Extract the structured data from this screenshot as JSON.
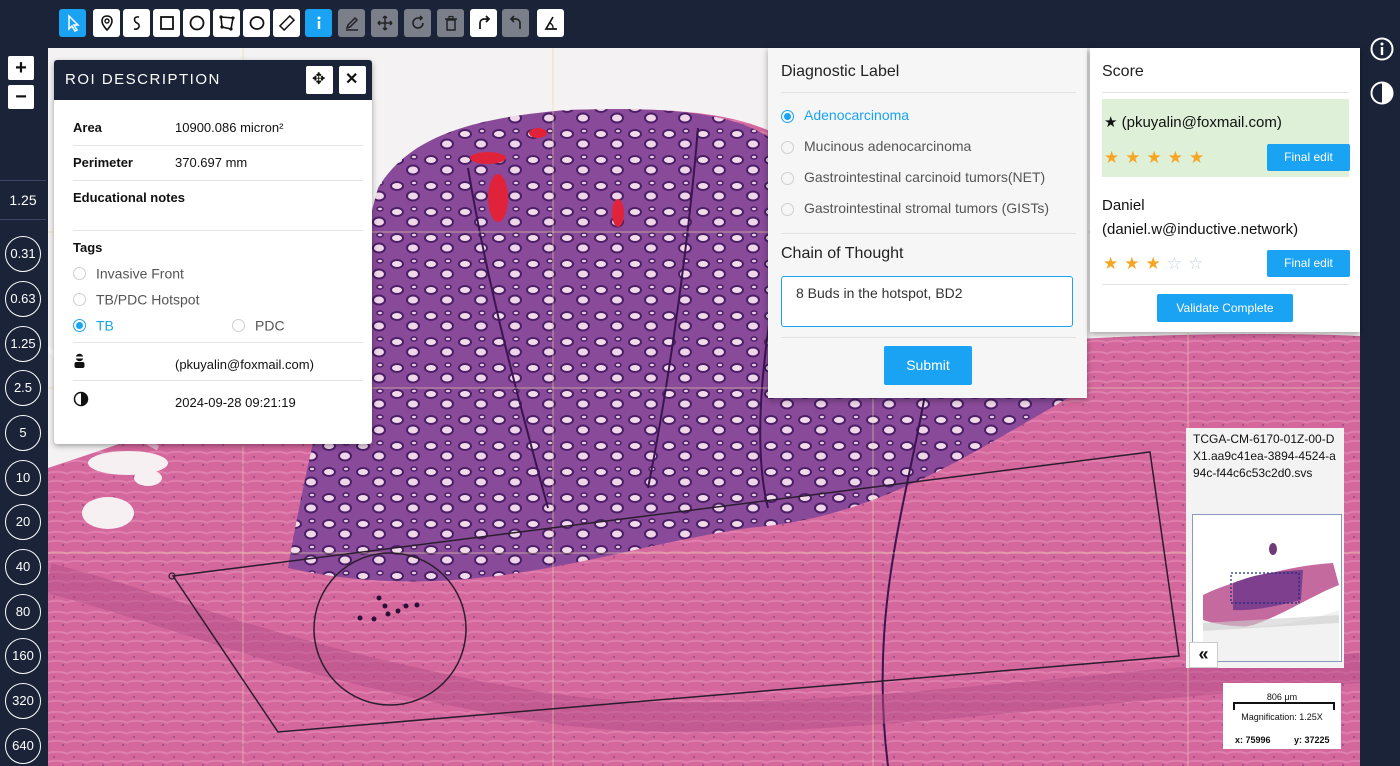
{
  "toolbar": {
    "tools": [
      {
        "name": "select-tool",
        "icon": "pointer-icon"
      },
      {
        "name": "point-tool",
        "icon": "map-pin-icon"
      },
      {
        "name": "freehand-tool",
        "icon": "freehand-icon"
      },
      {
        "name": "rectangle-tool",
        "icon": "square-icon"
      },
      {
        "name": "circle-tool",
        "icon": "circle-icon"
      },
      {
        "name": "polygon-tool",
        "icon": "polygon-icon"
      },
      {
        "name": "ellipse-tool",
        "icon": "ellipse-icon"
      },
      {
        "name": "ruler-tool",
        "icon": "ruler-icon"
      },
      {
        "name": "info-tool",
        "icon": "info-icon"
      },
      {
        "name": "edit-tool",
        "icon": "pencil-icon"
      },
      {
        "name": "move-tool",
        "icon": "move-icon"
      },
      {
        "name": "rotate-tool",
        "icon": "rotate-icon"
      },
      {
        "name": "delete-tool",
        "icon": "trash-icon"
      },
      {
        "name": "redo-tool",
        "icon": "redo-icon"
      },
      {
        "name": "undo-tool",
        "icon": "undo-icon"
      },
      {
        "name": "angle-tool",
        "icon": "angle-icon"
      }
    ]
  },
  "zoom": {
    "in_label": "+",
    "out_label": "−",
    "current": "1.25",
    "levels": [
      "0.31",
      "0.63",
      "1.25",
      "2.5",
      "5",
      "10",
      "20",
      "40",
      "80",
      "160",
      "320",
      "640"
    ]
  },
  "roi": {
    "title": "ROI DESCRIPTION",
    "area_label": "Area",
    "area_value": "10900.086 micron²",
    "perimeter_label": "Perimeter",
    "perimeter_value": "370.697 mm",
    "notes_label": "Educational notes",
    "tags_label": "Tags",
    "tags": {
      "invasive_front": "Invasive Front",
      "tb_pdc_hotspot": "TB/PDC Hotspot",
      "tb": "TB",
      "pdc": "PDC"
    },
    "selected_tag": "TB",
    "user": "(pkuyalin@foxmail.com)",
    "timestamp": "2024-09-28 09:21:19"
  },
  "diagnostic": {
    "title": "Diagnostic Label",
    "options": [
      "Adenocarcinoma",
      "Mucinous adenocarcinoma",
      "Gastrointestinal carcinoid tumors(NET)",
      "Gastrointestinal stromal tumors (GISTs)"
    ],
    "selected": "Adenocarcinoma",
    "cot_title": "Chain of Thought",
    "cot_value": "8 Buds in the hotspot, BD2",
    "submit_label": "Submit"
  },
  "score": {
    "title": "Score",
    "entries": [
      {
        "user": "(pkuyalin@foxmail.com)",
        "rating": 5,
        "button": "Final edit"
      },
      {
        "user_line1": "Daniel",
        "user_line2": "(daniel.w@inductive.network)",
        "rating": 3,
        "button": "Final edit"
      }
    ],
    "validate_label": "Validate Complete"
  },
  "slide": {
    "filename": "TCGA-CM-6170-01Z-00-DX1.aa9c41ea-3894-4524-a94c-f44c6c53c2d0.svs",
    "collapse_label": "«",
    "scale_label": "806 μm",
    "magnification": "Magnification: 1.25X",
    "x": "x: 75996",
    "y": "y: 37225"
  },
  "colors": {
    "accent": "#1aa3f3",
    "navbar": "#1b2339",
    "star": "#f5a623",
    "highlight": "#dff0d8",
    "tissue_pink": "#d56b9e",
    "gland_purple": "#5b2a7a"
  }
}
